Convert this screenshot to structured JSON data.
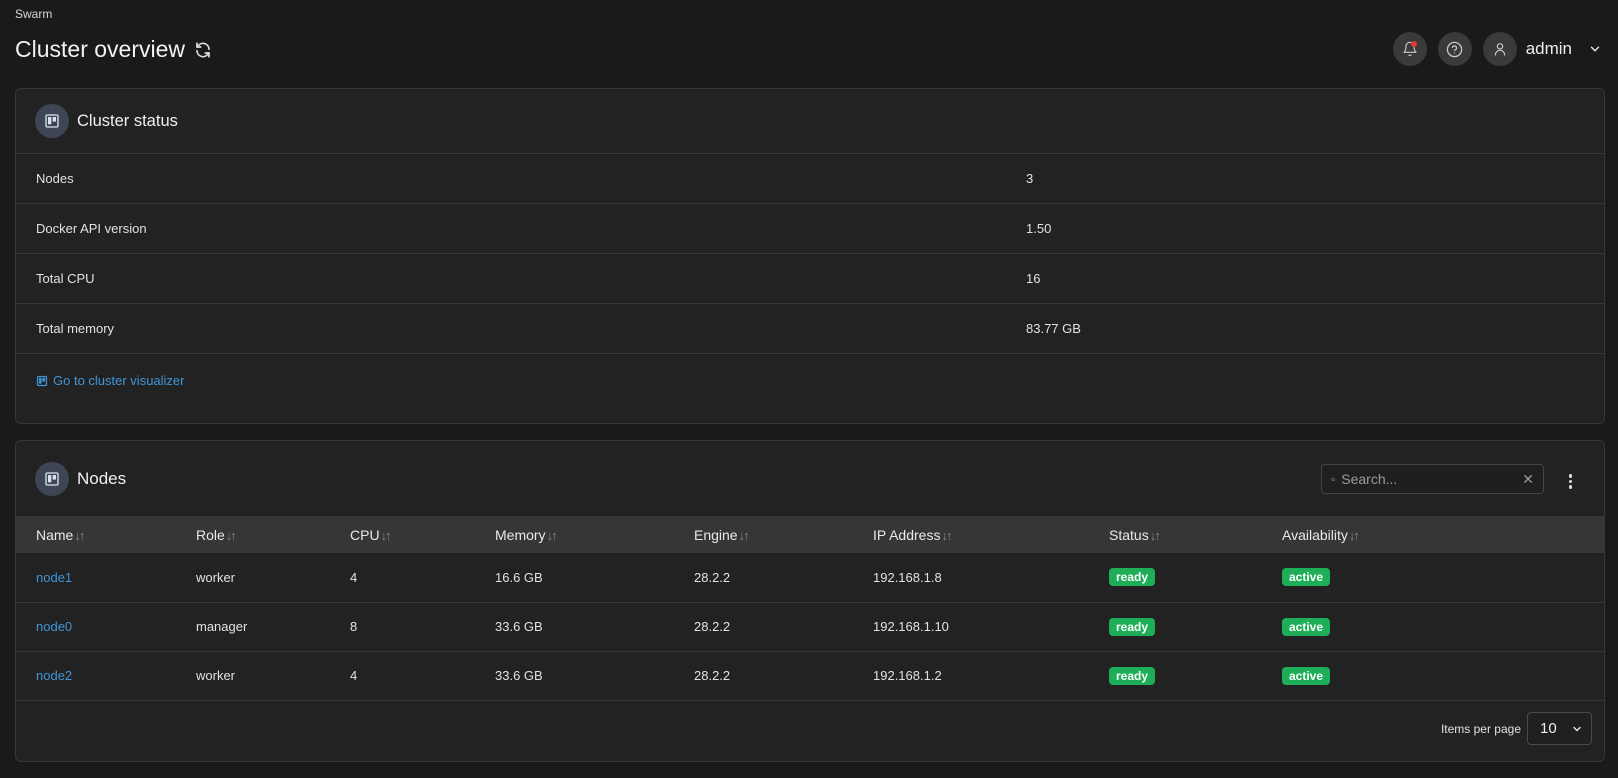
{
  "breadcrumb": "Swarm",
  "page_title": "Cluster overview",
  "user": {
    "name": "admin"
  },
  "cluster_status": {
    "title": "Cluster status",
    "rows": [
      {
        "key": "Nodes",
        "value": "3"
      },
      {
        "key": "Docker API version",
        "value": "1.50"
      },
      {
        "key": "Total CPU",
        "value": "16"
      },
      {
        "key": "Total memory",
        "value": "83.77 GB"
      }
    ],
    "visualizer_link": "Go to cluster visualizer"
  },
  "nodes": {
    "title": "Nodes",
    "search_placeholder": "Search...",
    "sort_indicator": "↓↑",
    "columns": [
      "Name",
      "Role",
      "CPU",
      "Memory",
      "Engine",
      "IP Address",
      "Status",
      "Availability"
    ],
    "rows": [
      {
        "name": "node1",
        "role": "worker",
        "cpu": "4",
        "memory": "16.6 GB",
        "engine": "28.2.2",
        "ip": "192.168.1.8",
        "status": "ready",
        "availability": "active"
      },
      {
        "name": "node0",
        "role": "manager",
        "cpu": "8",
        "memory": "33.6 GB",
        "engine": "28.2.2",
        "ip": "192.168.1.10",
        "status": "ready",
        "availability": "active"
      },
      {
        "name": "node2",
        "role": "worker",
        "cpu": "4",
        "memory": "33.6 GB",
        "engine": "28.2.2",
        "ip": "192.168.1.2",
        "status": "ready",
        "availability": "active"
      }
    ],
    "pagination": {
      "label": "Items per page",
      "value": "10"
    }
  },
  "colors": {
    "accent_link": "#3f96d9",
    "badge_green": "#1fae58",
    "notification_dot": "#e03a3a"
  }
}
